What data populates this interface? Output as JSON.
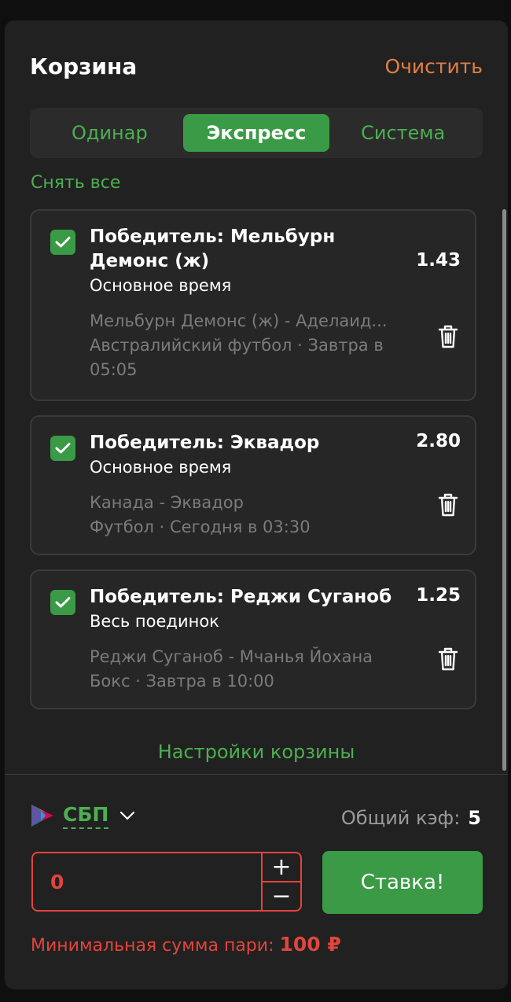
{
  "header": {
    "title": "Корзина",
    "clear_label": "Очистить"
  },
  "tabs": [
    {
      "label": "Одинар",
      "active": false
    },
    {
      "label": "Экспресс",
      "active": true
    },
    {
      "label": "Система",
      "active": false
    }
  ],
  "deselect_all_label": "Снять все",
  "bets": [
    {
      "name": "Победитель: Мельбурн Демонс (ж)",
      "odds": "1.43",
      "period": "Основное время",
      "match": "Мельбурн Демонс (ж) - Аделаид...",
      "info": "Австралийский футбол · Завтра в 05:05",
      "checked": true
    },
    {
      "name": "Победитель: Эквадор",
      "odds": "2.80",
      "period": "Основное время",
      "match": "Канада - Эквадор",
      "info": "Футбол · Сегодня в 03:30",
      "checked": true
    },
    {
      "name": "Победитель: Реджи Суганоб",
      "odds": "1.25",
      "period": "Весь поединок",
      "match": "Реджи Суганоб - Мчанья Йохана",
      "info": "Бокс · Завтра в 10:00",
      "checked": true
    }
  ],
  "settings_label": "Настройки корзины",
  "payment": {
    "name": "СБП"
  },
  "total": {
    "label": "Общий кэф:",
    "value": "5"
  },
  "stake": {
    "value": "0",
    "plus": "+",
    "minus": "−"
  },
  "bet_button_label": "Ставка!",
  "min_sum": {
    "label": "Минимальная сумма пари:",
    "value": "100 ₽"
  },
  "colors": {
    "accent_green": "#3a9a45",
    "link_green": "#4caf50",
    "error_red": "#e2453c",
    "clear_orange": "#e07f45"
  }
}
